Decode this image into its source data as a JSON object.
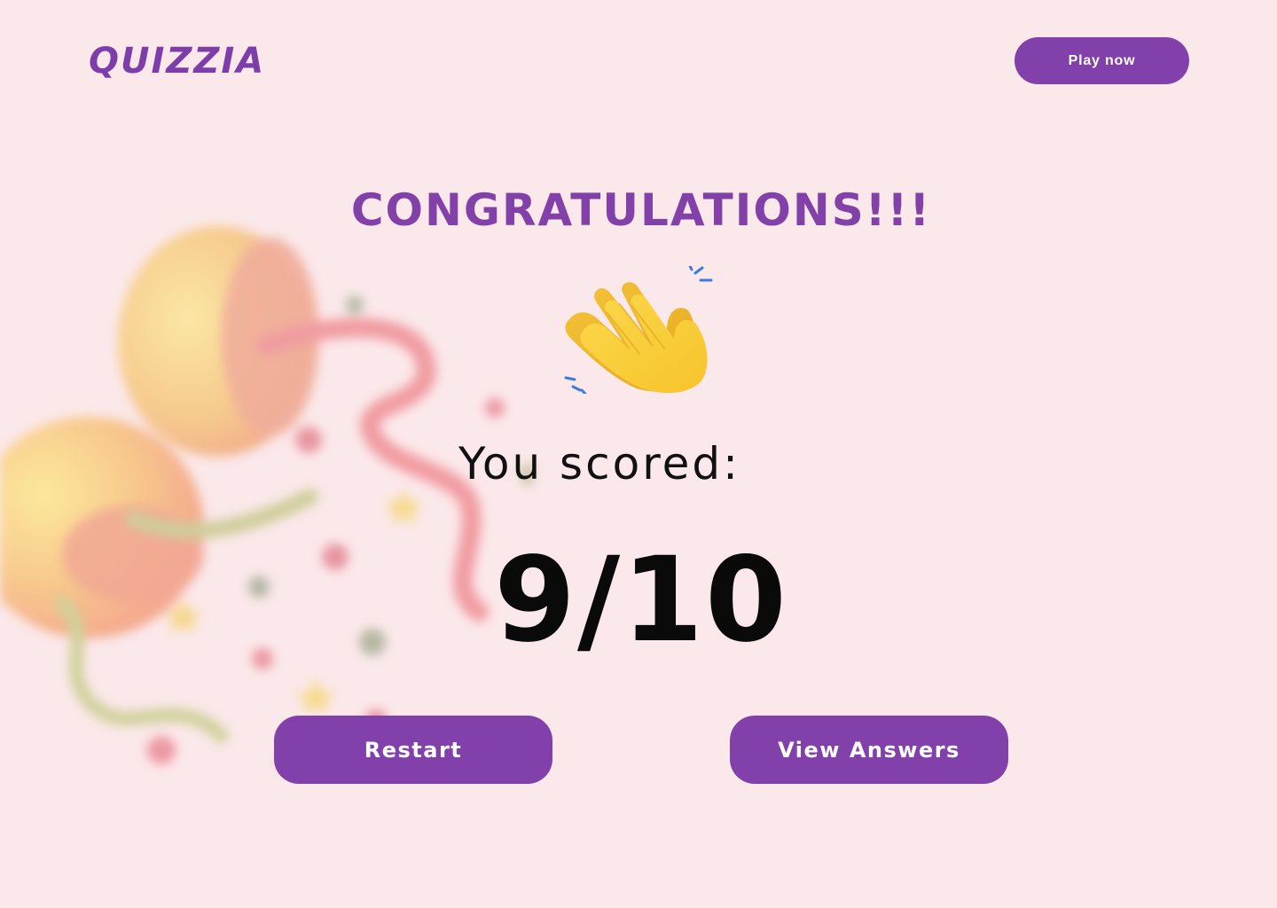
{
  "header": {
    "logo_text": "QUIZZIA",
    "play_now_label": "Play now"
  },
  "result": {
    "headline": "CONGRATULATIONS!!!",
    "celebration_icon": "clapping-hands-icon",
    "score_label": "You scored:",
    "score": "9/10",
    "score_correct": 9,
    "score_total": 10
  },
  "actions": {
    "restart_label": "Restart",
    "view_answers_label": "View Answers"
  },
  "decoration": {
    "background_art": "party-popper-confetti-icon"
  },
  "colors": {
    "background": "#fbe8ea",
    "brand_purple": "#8140aa",
    "text_dark": "#0a0a0a",
    "button_text": "#ffffff"
  }
}
